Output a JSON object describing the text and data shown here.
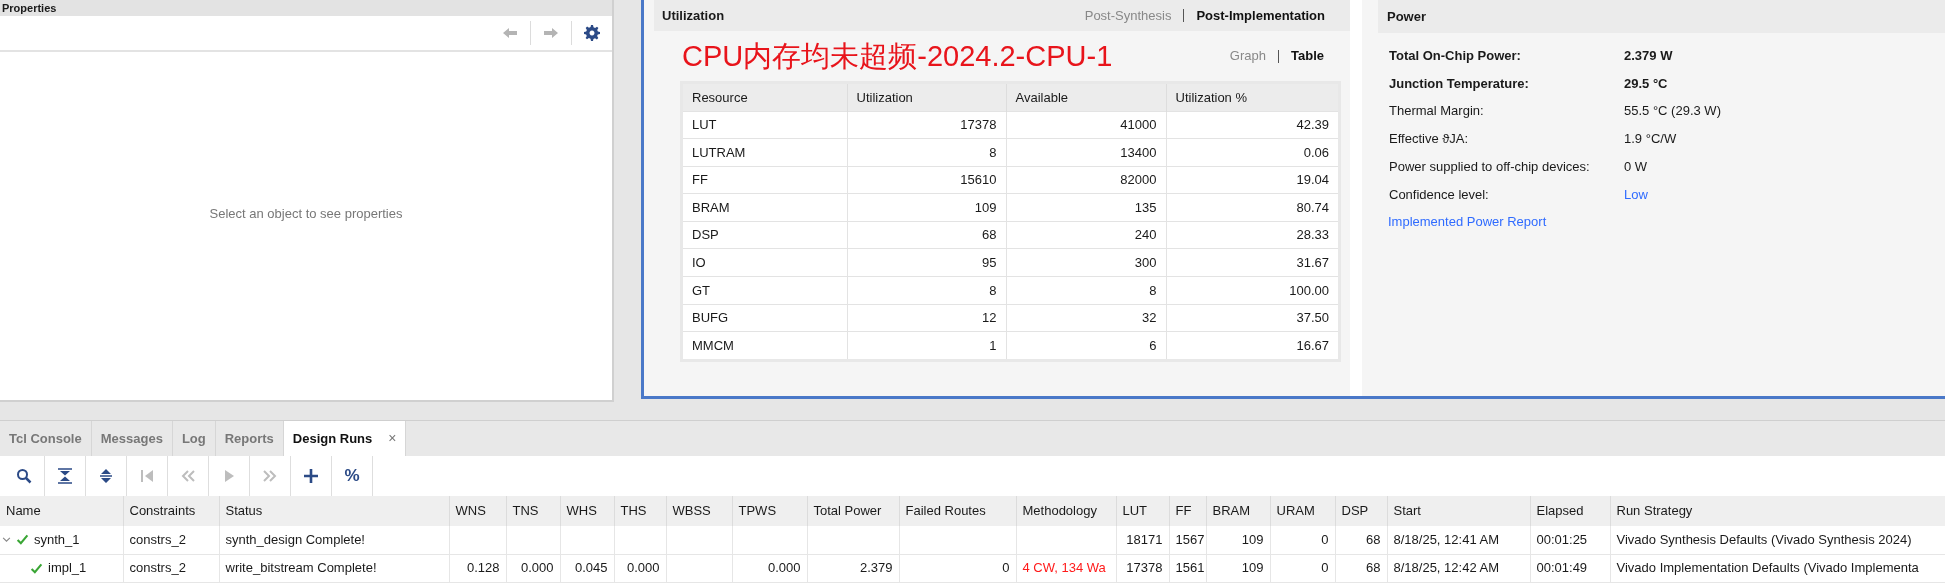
{
  "properties": {
    "title": "Properties",
    "nav": [
      {
        "kind": "back",
        "disabled": true
      },
      {
        "kind": "forward",
        "disabled": true
      },
      {
        "kind": "settings",
        "disabled": false
      }
    ],
    "empty_message": "Select an object to see properties"
  },
  "utilization": {
    "title": "Utilization",
    "views": [
      {
        "label": "Post-Synthesis",
        "selected": false
      },
      {
        "label": "Post-Implementation",
        "selected": true
      }
    ],
    "heading": "CPU内存均未超频-2024.2-CPU-1",
    "modes": [
      {
        "label": "Graph",
        "selected": false
      },
      {
        "label": "Table",
        "selected": true
      }
    ],
    "table": {
      "columns": [
        "Resource",
        "Utilization",
        "Available",
        "Utilization %"
      ],
      "rows": [
        [
          "LUT",
          "17378",
          "41000",
          "42.39"
        ],
        [
          "LUTRAM",
          "8",
          "13400",
          "0.06"
        ],
        [
          "FF",
          "15610",
          "82000",
          "19.04"
        ],
        [
          "BRAM",
          "109",
          "135",
          "80.74"
        ],
        [
          "DSP",
          "68",
          "240",
          "28.33"
        ],
        [
          "IO",
          "95",
          "300",
          "31.67"
        ],
        [
          "GT",
          "8",
          "8",
          "100.00"
        ],
        [
          "BUFG",
          "12",
          "32",
          "37.50"
        ],
        [
          "MMCM",
          "1",
          "6",
          "16.67"
        ]
      ]
    }
  },
  "power": {
    "title": "Power",
    "rows": [
      {
        "label": "Total On-Chip Power:",
        "value": "2.379 W",
        "bold": true,
        "link": false
      },
      {
        "label": "Junction Temperature:",
        "value": "29.5 °C",
        "bold": true,
        "link": false
      },
      {
        "label": "Thermal Margin:",
        "value": "55.5 °C (29.3 W)",
        "bold": false,
        "link": false
      },
      {
        "label": "Effective ϑJA:",
        "value": "1.9 °C/W",
        "bold": false,
        "link": false
      },
      {
        "label": "Power supplied to off-chip devices:",
        "value": "0 W",
        "bold": false,
        "link": false
      },
      {
        "label": "Confidence level:",
        "value": "Low",
        "bold": false,
        "link": true
      }
    ],
    "report_link": "Implemented Power Report"
  },
  "bottom_panel": {
    "tabs": [
      {
        "label": "Tcl Console",
        "selected": false,
        "closable": false
      },
      {
        "label": "Messages",
        "selected": false,
        "closable": false
      },
      {
        "label": "Log",
        "selected": false,
        "closable": false
      },
      {
        "label": "Reports",
        "selected": false,
        "closable": false
      },
      {
        "label": "Design Runs",
        "selected": true,
        "closable": true,
        "close_label": "×"
      }
    ],
    "toolbar": [
      {
        "kind": "search",
        "disabled": false
      },
      {
        "kind": "collapse_all",
        "disabled": false
      },
      {
        "kind": "expand_all",
        "disabled": false
      },
      {
        "kind": "first",
        "disabled": true
      },
      {
        "kind": "rewind",
        "disabled": true
      },
      {
        "kind": "play",
        "disabled": true
      },
      {
        "kind": "fast_forward",
        "disabled": true
      },
      {
        "kind": "add",
        "disabled": false
      },
      {
        "kind": "text",
        "label": "%",
        "disabled": false
      }
    ],
    "runs": {
      "columns": [
        "Name",
        "Constraints",
        "Status",
        "WNS",
        "TNS",
        "WHS",
        "THS",
        "WBSS",
        "TPWS",
        "Total Power",
        "Failed Routes",
        "Methodology",
        "LUT",
        "FF",
        "BRAM",
        "URAM",
        "DSP",
        "Start",
        "Elapsed",
        "Run Strategy"
      ],
      "rows": [
        {
          "complete": true,
          "expanded": true,
          "cells": [
            "synth_1",
            "constrs_2",
            "synth_design Complete!",
            "",
            "",
            "",
            "",
            "",
            "",
            "",
            "",
            "",
            "18171",
            "1567",
            "109",
            "0",
            "68",
            "8/18/25, 12:41 AM",
            "00:01:25",
            "Vivado Synthesis Defaults (Vivado Synthesis 2024)"
          ],
          "children": [
            {
              "complete": true,
              "methodology_warning": true,
              "cells": [
                "impl_1",
                "constrs_2",
                "write_bitstream Complete!",
                "0.128",
                "0.000",
                "0.045",
                "0.000",
                "",
                "0.000",
                "2.379",
                "0",
                "4 CW, 134 Wa",
                "17378",
                "1561",
                "109",
                "0",
                "68",
                "8/18/25, 12:42 AM",
                "00:01:49",
                "Vivado Implementation Defaults (Vivado Implementa"
              ]
            }
          ]
        }
      ]
    }
  }
}
